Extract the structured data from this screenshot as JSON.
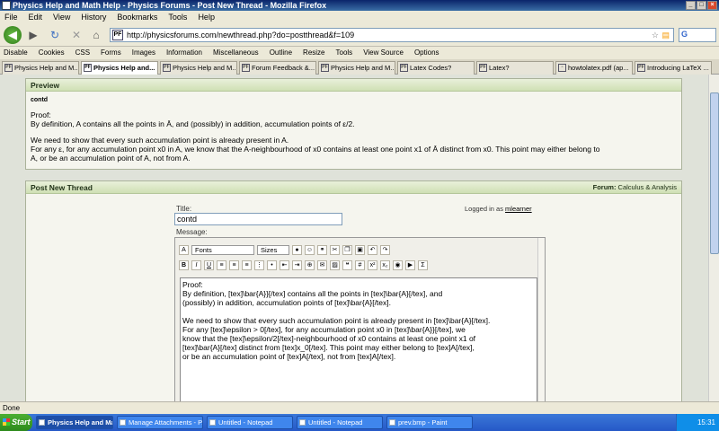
{
  "window": {
    "title": "Physics Help and Math Help - Physics Forums - Post New Thread - Mozilla Firefox"
  },
  "menu": [
    "File",
    "Edit",
    "View",
    "History",
    "Bookmarks",
    "Tools",
    "Help"
  ],
  "nav": {
    "url": "http://physicsforums.com/newthread.php?do=postthread&f=109",
    "favicon": "PF"
  },
  "devbar": [
    "Disable",
    "Cookies",
    "CSS",
    "Forms",
    "Images",
    "Information",
    "Miscellaneous",
    "Outline",
    "Resize",
    "Tools",
    "View Source",
    "Options"
  ],
  "tabs": [
    "Physics Help and M...",
    "Physics Help and...",
    "Physics Help and M...",
    "Forum Feedback &...",
    "Physics Help and M...",
    "Latex Codes?",
    "Latex?",
    "howtolatex.pdf (ap...",
    "Introducing LaTeX ..."
  ],
  "preview": {
    "header": "Preview",
    "thread_title": "contd",
    "lines": [
      "Proof:",
      "By definition, A contains all the points in Ā, and (possibly) in addition, accumulation points of ε/2.",
      "",
      "We need to show that every such accumulation point is already present in A.",
      "For any ε, for any accumulation point x0 in A, we know that the A-neighbourhood of x0 contains at least one point x1 of Ā distinct from x0. This point may either belong to",
      "A, or be an accumulation point of A, not from A."
    ]
  },
  "newthread": {
    "header": "Post New Thread",
    "forum_label": "Forum:",
    "forum_name": "Calculus & Analysis",
    "logged_in_prefix": "Logged in as",
    "username": "mlearner",
    "title_label": "Title:",
    "title_value": "contd",
    "message_label": "Message:",
    "font_select": "Fonts",
    "size_select": "Sizes",
    "editor_lines": [
      "Proof:",
      "By definition, [tex]\\bar{A}}[/tex] contains all the points in [tex]\\bar{A}[/tex], and",
      "(possibly) in addition, accumulation points of [tex]\\bar{A}[/tex].",
      "",
      "We need to show that every such accumulation point is already present in [tex]\\bar{A}[/tex].",
      "For any [tex]\\epsilon > 0[/tex], for any accumulation point x0 in [tex]\\bar{A}}[/tex], we",
      "know that the [tex]\\epsilon/2[/tex]-neighbourhood of x0 contains at least one point x1 of",
      "[tex]\\bar{A}[/tex] distinct from [tex]x_0[/tex]. This point may either belong to [tex]A[/tex],",
      "or be an accumulation point of [tex]A[/tex], not from [tex]A[/tex]."
    ]
  },
  "status": "Done",
  "taskbar": {
    "start": "Start",
    "tasks": [
      "Physics Help and Math...",
      "Manage Attachments - P...",
      "Untitled - Notepad",
      "Untitled - Notepad",
      "prev.bmp - Paint"
    ],
    "clock": "15:31"
  }
}
